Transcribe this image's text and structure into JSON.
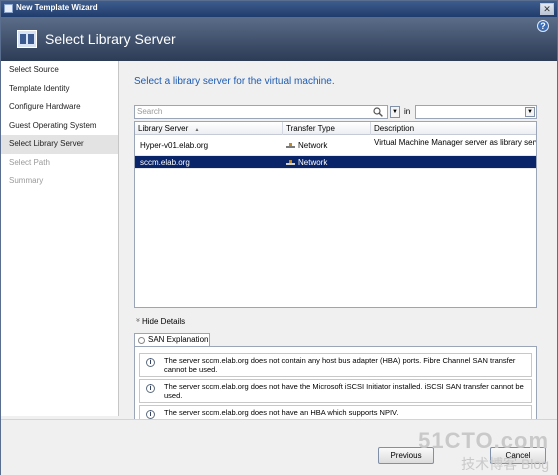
{
  "window": {
    "title": "New Template Wizard",
    "close_glyph": "✕"
  },
  "header": {
    "title": "Select Library Server",
    "help_glyph": "?"
  },
  "sidebar": {
    "items": [
      {
        "label": "Select Source",
        "state": "normal"
      },
      {
        "label": "Template Identity",
        "state": "normal"
      },
      {
        "label": "Configure Hardware",
        "state": "normal"
      },
      {
        "label": "Guest Operating System",
        "state": "normal"
      },
      {
        "label": "Select Library Server",
        "state": "active"
      },
      {
        "label": "Select Path",
        "state": "disabled"
      },
      {
        "label": "Summary",
        "state": "disabled"
      }
    ]
  },
  "main": {
    "subtitle": "Select a library server for the virtual machine.",
    "search": {
      "placeholder": "Search",
      "in_label": "in",
      "in_value": ""
    },
    "table": {
      "columns": [
        "Library Server",
        "Transfer Type",
        "Description"
      ],
      "sort_glyph": "▲",
      "rows": [
        {
          "server": "Hyper-v01.elab.org",
          "transfer": "Network",
          "description": "Virtual Machine Manager server as library server",
          "selected": false
        },
        {
          "server": "sccm.elab.org",
          "transfer": "Network",
          "description": "",
          "selected": true
        }
      ]
    },
    "details": {
      "toggle_label": "Hide Details",
      "toggle_glyph": "»",
      "tab_label": "SAN Explanation",
      "messages": [
        "The server sccm.elab.org does not contain any host bus adapter (HBA) ports. Fibre Channel SAN transfer cannot be used.",
        "The server sccm.elab.org does not have the Microsoft iSCSI Initiator installed. iSCSI SAN transfer cannot be used.",
        "The server sccm.elab.org does not have an HBA which supports NPIV."
      ]
    }
  },
  "footer": {
    "previous_label": "Previous",
    "cancel_label": "Cancel"
  },
  "watermark": {
    "line1": "51CTO.com",
    "line2": "技术博客 Blog"
  },
  "colors": {
    "accent": "#1e5bb0",
    "selection": "#0a246a",
    "header": "#2c3b56"
  }
}
